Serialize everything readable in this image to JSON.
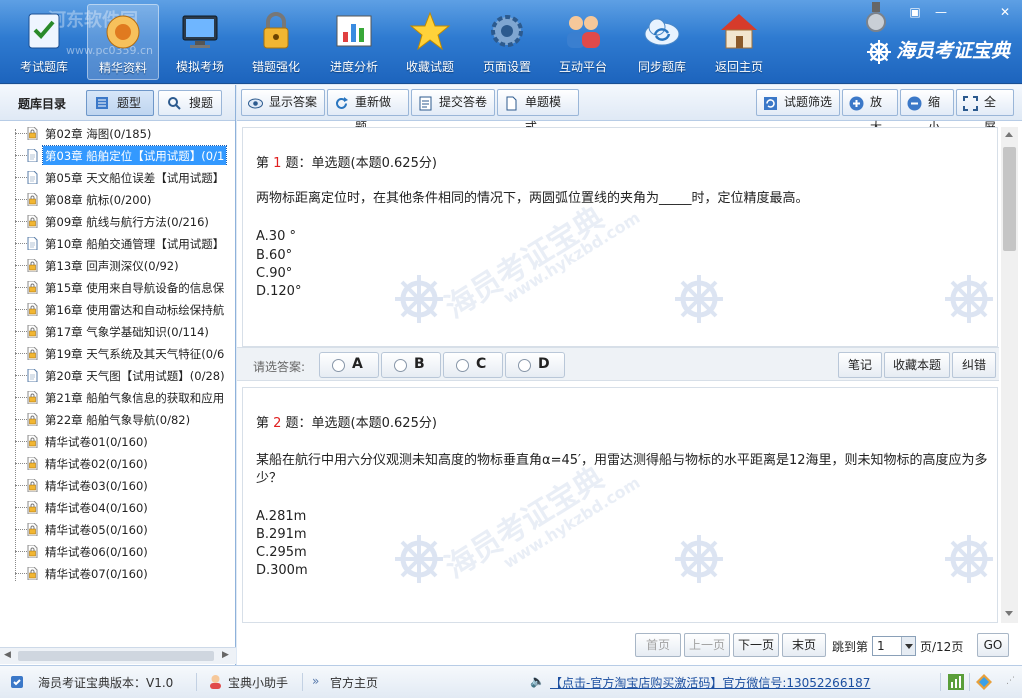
{
  "toolbar": {
    "items": [
      {
        "label": "考试题库",
        "icon": "question-bank-icon"
      },
      {
        "label": "精华资料",
        "icon": "essentials-icon",
        "active": true
      },
      {
        "label": "模拟考场",
        "icon": "monitor-icon"
      },
      {
        "label": "错题强化",
        "icon": "lock-icon"
      },
      {
        "label": "进度分析",
        "icon": "chart-icon"
      },
      {
        "label": "收藏试题",
        "icon": "star-icon"
      },
      {
        "label": "页面设置",
        "icon": "gear-icon"
      },
      {
        "label": "互动平台",
        "icon": "users-icon"
      },
      {
        "label": "同步题库",
        "icon": "cloud-sync-icon"
      },
      {
        "label": "返回主页",
        "icon": "home-icon"
      }
    ],
    "watermark_url": "www.pc0359.cn",
    "brand": "海员考证宝典"
  },
  "left": {
    "title": "题库目录",
    "tab_type": "题型",
    "tab_search": "搜题",
    "tree": [
      {
        "label": "第02章  海图(0/185)",
        "locked": true
      },
      {
        "label": "第03章  船舶定位【试用试题】(0/1",
        "locked": false,
        "selected": true
      },
      {
        "label": "第05章  天文船位误差【试用试题】",
        "locked": false
      },
      {
        "label": "第08章  航标(0/200)",
        "locked": true
      },
      {
        "label": "第09章  航线与航行方法(0/216)",
        "locked": true
      },
      {
        "label": "第10章  船舶交通管理【试用试题】",
        "locked": false
      },
      {
        "label": "第13章  回声测深仪(0/92)",
        "locked": true
      },
      {
        "label": "第15章  使用来自导航设备的信息保",
        "locked": true
      },
      {
        "label": "第16章  使用雷达和自动标绘保持航",
        "locked": true
      },
      {
        "label": "第17章  气象学基础知识(0/114)",
        "locked": true
      },
      {
        "label": "第19章  天气系统及其天气特征(0/6",
        "locked": true
      },
      {
        "label": "第20章  天气图【试用试题】(0/28)",
        "locked": false
      },
      {
        "label": "第21章  船舶气象信息的获取和应用",
        "locked": true
      },
      {
        "label": "第22章  船舶气象导航(0/82)",
        "locked": true
      },
      {
        "label": "精华试卷01(0/160)",
        "locked": true
      },
      {
        "label": "精华试卷02(0/160)",
        "locked": true
      },
      {
        "label": "精华试卷03(0/160)",
        "locked": true
      },
      {
        "label": "精华试卷04(0/160)",
        "locked": true
      },
      {
        "label": "精华试卷05(0/160)",
        "locked": true
      },
      {
        "label": "精华试卷06(0/160)",
        "locked": true
      },
      {
        "label": "精华试卷07(0/160)",
        "locked": true
      }
    ]
  },
  "main": {
    "tools_left": [
      "显示答案",
      "重新做题",
      "提交答卷",
      "单题模式"
    ],
    "tools_right": [
      "试题筛选",
      "放大",
      "缩小",
      "全屏"
    ],
    "q1": {
      "prefix": "第 ",
      "num": "1",
      "suffix": " 题：单选题(本题0.625分)",
      "text": "两物标距离定位时，在其他条件相同的情况下，两圆弧位置线的夹角为_____时，定位精度最高。",
      "options": [
        "A.30 °",
        "B.60°",
        "C.90°",
        "D.120°"
      ]
    },
    "answer_bar": {
      "label": "请选答案:",
      "choices": [
        "A",
        "B",
        "C",
        "D"
      ],
      "actions": [
        "笔记",
        "收藏本题",
        "纠错"
      ]
    },
    "q2": {
      "prefix": "第 ",
      "num": "2",
      "suffix": " 题：单选题(本题0.625分)",
      "text": "某船在航行中用六分仪观测未知高度的物标垂直角α=45′，用雷达测得船与物标的水平距离是12海里，则未知物标的高度应为多少？",
      "options": [
        "A.281m",
        "B.291m",
        "C.295m",
        "D.300m"
      ]
    },
    "watermark_text": "海员考证宝典",
    "watermark_url": "www.hykzbd.com",
    "pager": {
      "first": "首页",
      "prev": "上一页",
      "next": "下一页",
      "last": "末页",
      "goto_label": "跳到第",
      "page_value": "1",
      "total": "页/12页",
      "go": "GO"
    }
  },
  "status": {
    "version": "海员考证宝典版本：V1.0",
    "assistant": "宝典小助手",
    "homepage": "官方主页",
    "promo": "【点击-官方淘宝店购买激活码】官方微信号:13052266187"
  },
  "colors": {
    "toolbar_top": "#5ea0e4",
    "toolbar_bottom": "#1d64bd",
    "question_number": "#e02020",
    "selection": "#3399ff"
  }
}
